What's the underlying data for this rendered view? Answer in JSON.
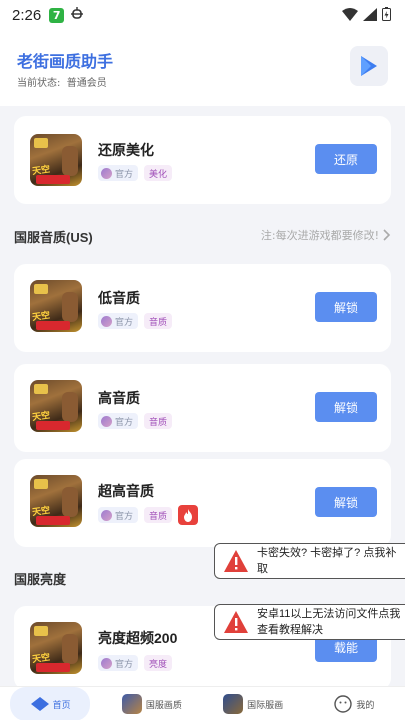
{
  "statusbar": {
    "time": "2:26",
    "app_badge": "7"
  },
  "header": {
    "title": "老街画质助手",
    "status_label": "当前状态:",
    "status_value": "普通会员"
  },
  "top_card": {
    "title": "还原美化",
    "tag_official": "官方",
    "tag_cat": "美化",
    "button": "还原"
  },
  "section1": {
    "title": "国服音质(US)",
    "note": "注:每次进游戏都要修改!"
  },
  "items": [
    {
      "title": "低音质",
      "tag_official": "官方",
      "tag_cat": "音质",
      "button": "解锁"
    },
    {
      "title": "高音质",
      "tag_official": "官方",
      "tag_cat": "音质",
      "button": "解锁"
    },
    {
      "title": "超高音质",
      "tag_official": "官方",
      "tag_cat": "音质",
      "button": "解锁"
    }
  ],
  "section2": {
    "title": "国服亮度"
  },
  "bright_item": {
    "title": "亮度超频200",
    "tag_official": "官方",
    "tag_cat": "亮度",
    "button": "载能"
  },
  "toasts": [
    {
      "text": "卡密失效? 卡密掉了? 点我补取"
    },
    {
      "text": "安卓11以上无法访问文件点我查看教程解决"
    }
  ],
  "bottom_nav": {
    "home": "首页",
    "tab2": "国服画质",
    "tab3": "国际服画",
    "tab4": "我的"
  },
  "colors": {
    "accent": "#5b8ef0",
    "title": "#3d6fe0",
    "tag_cat": "#a04fb8"
  }
}
